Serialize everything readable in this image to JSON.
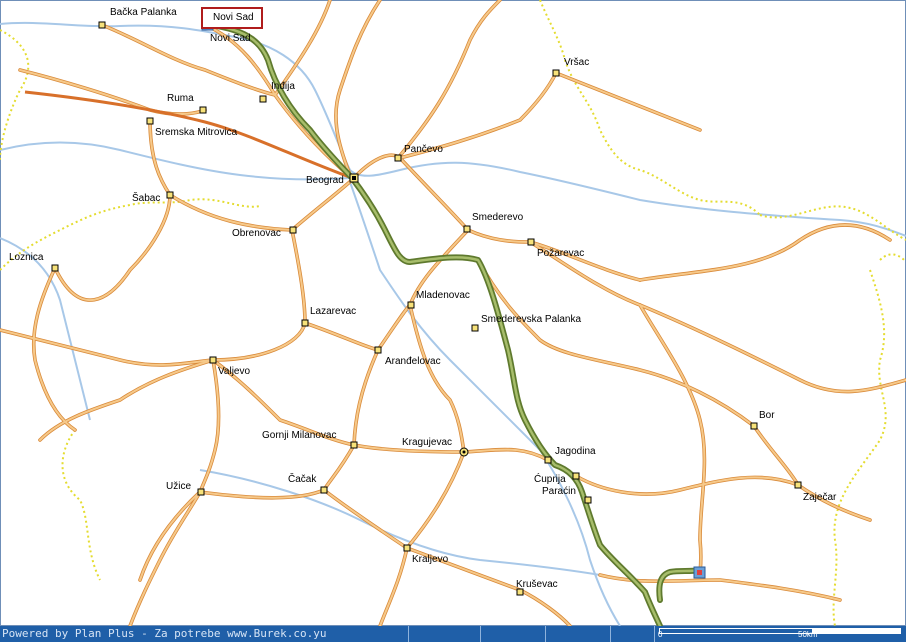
{
  "route": {
    "start_label": "Novi Sad"
  },
  "cities": [
    {
      "name": "Bačka Palanka",
      "kind": "town"
    },
    {
      "name": "Novi Sad",
      "kind": "town"
    },
    {
      "name": "Vršac",
      "kind": "town"
    },
    {
      "name": "Inđija",
      "kind": "town"
    },
    {
      "name": "Ruma",
      "kind": "town"
    },
    {
      "name": "Sremska Mitrovica",
      "kind": "town"
    },
    {
      "name": "Pančevo",
      "kind": "town"
    },
    {
      "name": "Beograd",
      "kind": "capital"
    },
    {
      "name": "Šabac",
      "kind": "town"
    },
    {
      "name": "Smederevo",
      "kind": "town"
    },
    {
      "name": "Obrenovac",
      "kind": "town"
    },
    {
      "name": "Požarevac",
      "kind": "town"
    },
    {
      "name": "Loznica",
      "kind": "town"
    },
    {
      "name": "Mladenovac",
      "kind": "town"
    },
    {
      "name": "Lazarevac",
      "kind": "town"
    },
    {
      "name": "Smederevska Palanka",
      "kind": "town"
    },
    {
      "name": "Aranđelovac",
      "kind": "town"
    },
    {
      "name": "Valjevo",
      "kind": "town"
    },
    {
      "name": "Bor",
      "kind": "town"
    },
    {
      "name": "Gornji Milanovac",
      "kind": "town"
    },
    {
      "name": "Kragujevac",
      "kind": "regional"
    },
    {
      "name": "Jagodina",
      "kind": "town"
    },
    {
      "name": "Ćuprija",
      "kind": "town"
    },
    {
      "name": "Paraćin",
      "kind": "town"
    },
    {
      "name": "Čačak",
      "kind": "town"
    },
    {
      "name": "Užice",
      "kind": "town"
    },
    {
      "name": "Zaječar",
      "kind": "town"
    },
    {
      "name": "Kraljevo",
      "kind": "town"
    },
    {
      "name": "Kruševac",
      "kind": "town"
    }
  ],
  "status_bar": {
    "credit": "Powered by Plan Plus - Za potrebe www.Burek.co.yu"
  },
  "scale": {
    "zero": "0",
    "distance": "50km"
  },
  "colors": {
    "road": "#f0b060",
    "road_casing": "#d98a3a",
    "motorway": "#d8702a",
    "route": "#6e8a3a",
    "border": "#d8d820",
    "water": "#a8c8e8",
    "statusbar": "#1f5fa8"
  }
}
